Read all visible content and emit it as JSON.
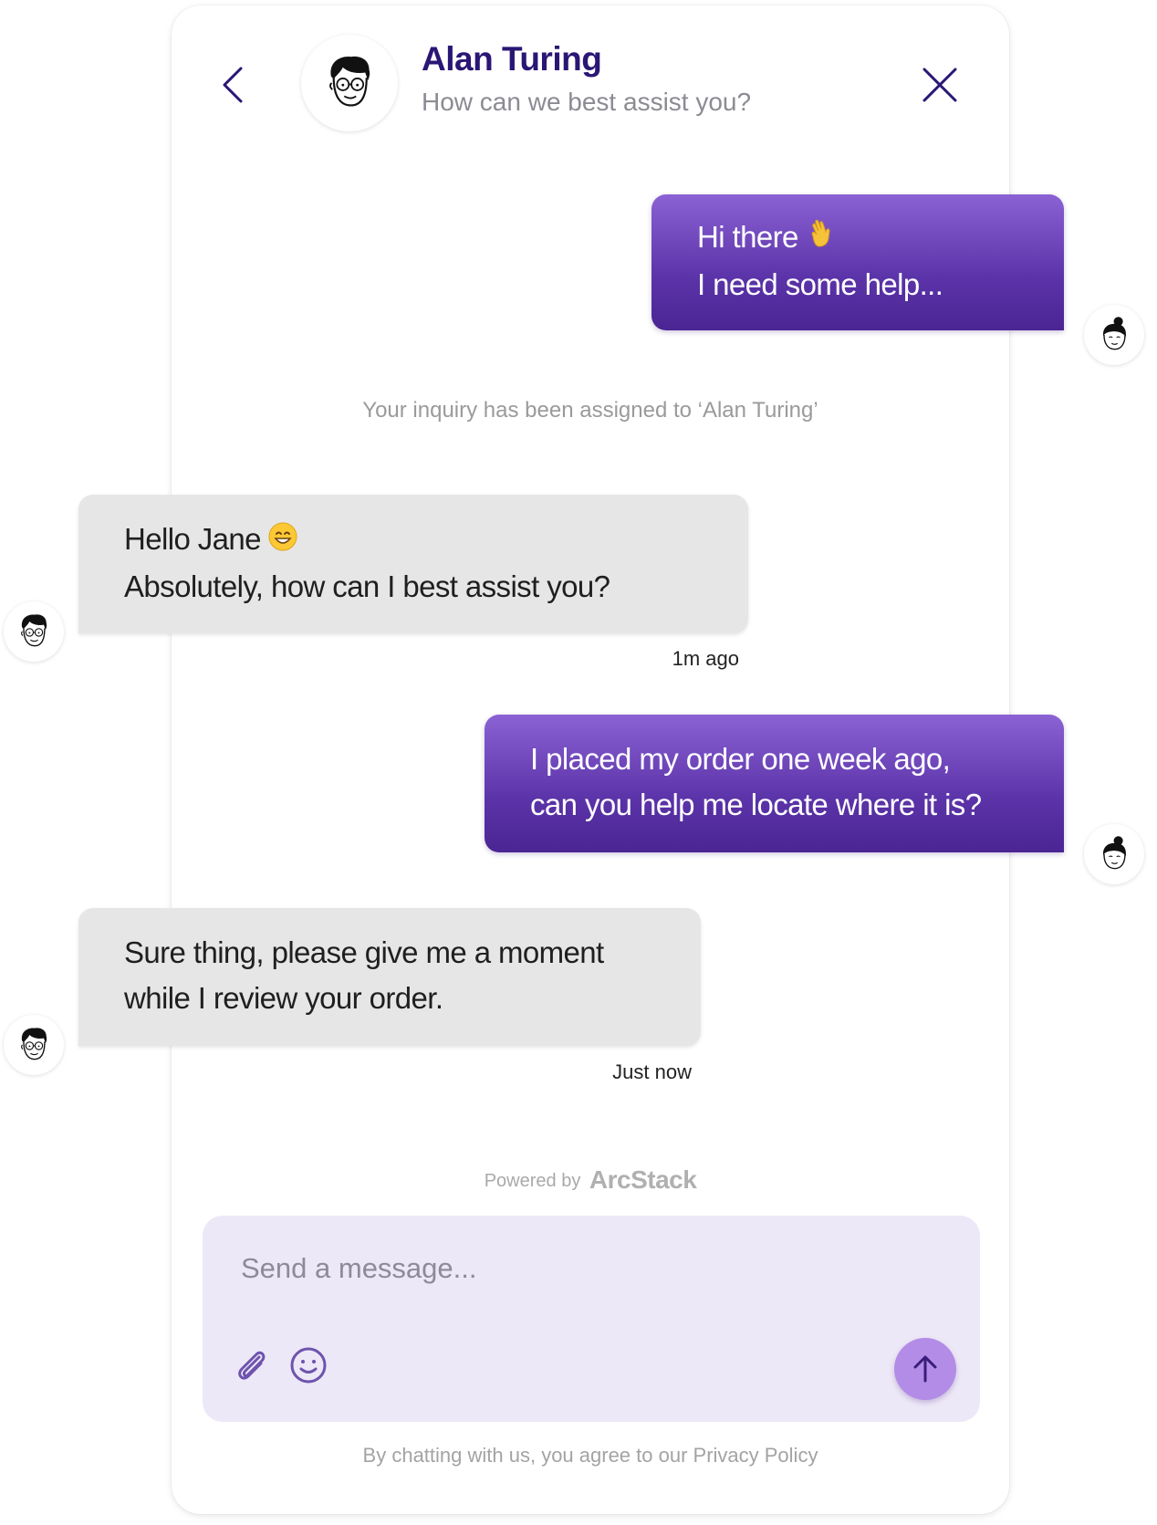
{
  "header": {
    "agent_name": "Alan Turing",
    "subtitle": "How can we best assist you?"
  },
  "messages": [
    {
      "from": "user",
      "lines": [
        "Hi there",
        "I need some help..."
      ],
      "emoji": "waving-hand-emoji"
    },
    {
      "from": "agent",
      "lines": [
        "Hello Jane",
        "Absolutely, how can I best assist you?"
      ],
      "emoji": "grinning-face-emoji",
      "time": "1m ago"
    },
    {
      "from": "user",
      "lines": [
        "I placed my order one week ago,",
        "can you help me locate where it is?"
      ]
    },
    {
      "from": "agent",
      "lines": [
        "Sure thing, please give me a moment",
        "while I review your order."
      ],
      "time": "Just now"
    }
  ],
  "system_note": "Your inquiry has been assigned to ‘Alan Turing’",
  "footer": {
    "powered_prefix": "Powered by",
    "powered_brand": "ArcStack",
    "input_placeholder": "Send a message...",
    "legal": "By chatting with us, you agree to our Privacy Policy"
  },
  "colors": {
    "accent_dark": "#2a1674",
    "user_bubble_top": "#8b62d4",
    "user_bubble_bottom": "#4a2593",
    "agent_bubble": "#e6e6e6",
    "composer_bg": "#ede8f7",
    "send_button": "#b28ce6"
  }
}
